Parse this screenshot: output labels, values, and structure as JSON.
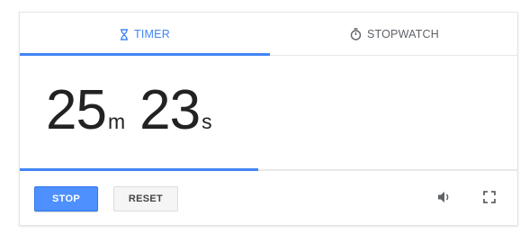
{
  "tabs": {
    "timer_label": "TIMER",
    "stopwatch_label": "STOPWATCH",
    "active": "timer"
  },
  "timer": {
    "minutes": "25",
    "minutes_unit": "m",
    "seconds": "23",
    "seconds_unit": "s",
    "progress_fraction": 0.48
  },
  "controls": {
    "stop_label": "STOP",
    "reset_label": "RESET",
    "volume_icon": "volume-icon",
    "fullscreen_icon": "fullscreen-icon"
  },
  "colors": {
    "accent": "#4285f4",
    "stop_button": "#4d90fe",
    "text": "#222222",
    "muted": "#5f6368"
  }
}
